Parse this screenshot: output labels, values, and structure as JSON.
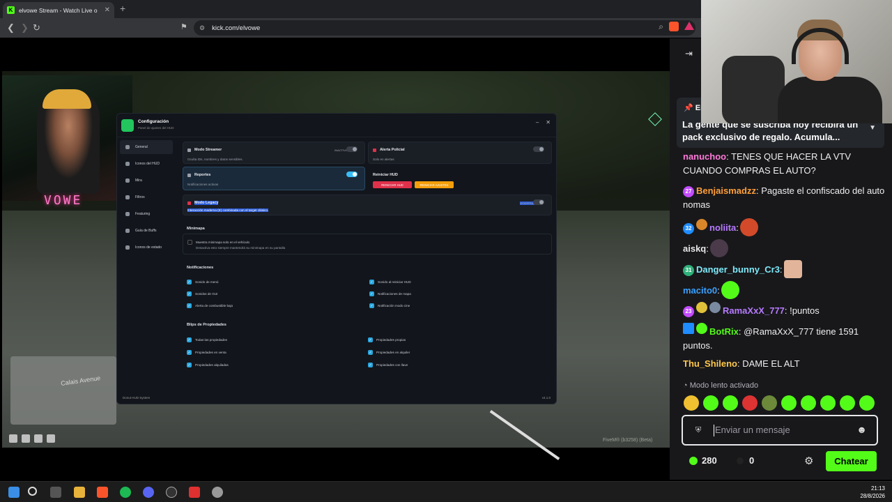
{
  "browser": {
    "tab_title": "elvowe Stream - Watch Live o",
    "tab_favicon": "K",
    "new_tab": "+",
    "url": "kick.com/elvowe"
  },
  "stream": {
    "overlay_name": "VOWE",
    "minimap_street": "Calais Avenue",
    "fivem_build": "FiveM® (b3258) (Beta)"
  },
  "config": {
    "title": "Configuración",
    "subtitle": "Panel de ajustes del HUD",
    "sidebar": [
      {
        "label": "General"
      },
      {
        "label": "Iconos del HUD"
      },
      {
        "label": "Mira"
      },
      {
        "label": "Filtros"
      },
      {
        "label": "Featuring"
      },
      {
        "label": "Guía de Buffs"
      },
      {
        "label": "Iconos de estado"
      }
    ],
    "streamer_mode": {
      "title": "Modo Streamer",
      "desc": "Oculta IDs, nombres y datos sensibles.",
      "tag": "INACTIVO"
    },
    "police_alert": {
      "title": "Alerta Policial",
      "desc": "Solo en alertas"
    },
    "reports": {
      "title": "Reportes",
      "desc": "Notificaciones activas"
    },
    "restart_hud": {
      "title": "Reiniciar HUD",
      "btn1": "REINICIAR HUD",
      "btn2": "REINICIAR AJUSTES"
    },
    "legacy": {
      "title": "Modo Legacy",
      "desc": "Interacción moderna (E) combinada con el target clásico.",
      "tag": "MODERNO"
    },
    "minimap": {
      "section": "Minimapa",
      "opt_title": "Muestra minimapa solo en el vehículo",
      "opt_desc": "Desactiva esto siempre mantendrá su minimapa en su pantalla"
    },
    "notifications": {
      "section": "Notificaciones",
      "left": [
        "Sonido de menú",
        "Sonidos de GUI",
        "Alerta de combustible bajo"
      ],
      "right": [
        "Sonido al reiniciar HUD",
        "Notificaciones de mapa",
        "Notificación modo cine"
      ]
    },
    "blips": {
      "section": "Blips de Propiedades",
      "left": [
        "Todas las propiedades",
        "Propiedades en venta",
        "Propiedades alquiladas"
      ],
      "right": [
        "Propiedades propias",
        "Propiedades en alquiler",
        "Propiedades con llave"
      ]
    },
    "footer_left": "Donut HUD System",
    "footer_right": "v4.1.0"
  },
  "chat": {
    "pinned_prefix": "En",
    "pinned_text": "La gente que se suscriba hoy recibirá un pack exclusivo de regalo. Acumula...",
    "messages": [
      {
        "badge": "",
        "user": "nanuchoo",
        "color": "#ff7ad9",
        "text": ": TENES QUE HACER LA VTV CUANDO COMPRAS EL AUTO?"
      },
      {
        "badge": "27",
        "user": "Benjaismadzz",
        "color": "#ff9f3a",
        "text": ": Pagaste el confiscado del auto nomas"
      },
      {
        "badge": "32",
        "user": "noliita",
        "color": "#b77bff",
        "text": ":"
      },
      {
        "badge": "",
        "user": "aiskq",
        "color": "#e8e8ea",
        "text": ":"
      },
      {
        "badge": "31",
        "user": "Danger_bunny_Cr3",
        "color": "#7ee8f7",
        "text": ":"
      },
      {
        "badge": "",
        "user": "macito0",
        "color": "#3aa0ff",
        "text": ":"
      },
      {
        "badge": "23",
        "user": "RamaXxX_777",
        "color": "#b77bff",
        "text": ": !puntos"
      },
      {
        "badge": "",
        "user": "BotRix",
        "color": "#53fc18",
        "text": ": @RamaXxX_777 tiene 1591 puntos."
      },
      {
        "badge": "",
        "user": "Thu_Shileno",
        "color": "#ffc84a",
        "text": ": DAME EL ALT"
      }
    ],
    "slow_mode": "Modo lento activado",
    "input_placeholder": "Enviar un mensaje",
    "points": "280",
    "points2": "0",
    "chat_button": "Chatear"
  },
  "taskbar": {
    "time": "21:13",
    "date": "28/8/2026"
  },
  "colors": {
    "kick_green": "#53fc18",
    "toggle_on": "#38bdf8",
    "danger": "#e0314b",
    "warn": "#f59e0b"
  }
}
